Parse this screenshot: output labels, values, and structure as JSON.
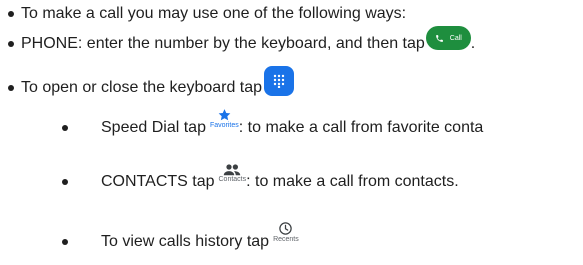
{
  "lines": {
    "l1": "To make a call you may use one of the following ways:",
    "l2": "PHONE: enter the number by the keyboard, and then tap",
    "l2_end": ".",
    "l3": "To open or close the keyboard tap",
    "l4_pre": "Speed Dial tap",
    "l4_post": ": to make a call from favorite conta",
    "l5_pre": "CONTACTS tap",
    "l5_post": ": to make a call from contacts.",
    "l6_pre": "To view calls history tap"
  },
  "buttons": {
    "call_label": "Call",
    "favorites_label": "Favorites",
    "contacts_label": "Contacts",
    "recents_label": "Recents"
  },
  "colors": {
    "call_green": "#1e8e3e",
    "dialpad_blue": "#1a73e8",
    "favorites_blue": "#1a73e8",
    "icon_gray": "#5f6368",
    "text": "#1f1f1f"
  },
  "icons": {
    "call": "phone-icon",
    "dialpad": "dialpad-icon",
    "favorites": "star-icon",
    "contacts": "people-icon",
    "recents": "clock-icon"
  }
}
